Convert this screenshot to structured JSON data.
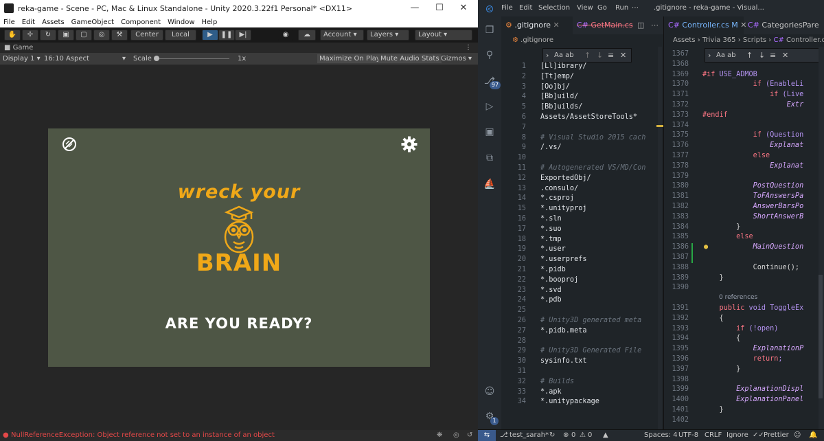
{
  "unity": {
    "title": "reka-game - Scene - PC, Mac & Linux Standalone - Unity 2020.3.22f1 Personal* <DX11>",
    "menu": [
      "File",
      "Edit",
      "Assets",
      "GameObject",
      "Component",
      "Window",
      "Help"
    ],
    "toolbar": {
      "center": "Center",
      "local": "Local",
      "account": "Account",
      "layers": "Layers",
      "layout": "Layout"
    },
    "game_tab": "Game",
    "gamebar": {
      "display": "Display 1",
      "aspect": "16:10 Aspect",
      "scale_label": "Scale",
      "scale_value": "1x",
      "maximize": "Maximize On Play",
      "mute": "Mute Audio",
      "stats": "Stats",
      "gizmos": "Gizmos"
    },
    "game": {
      "line1": "wreck your",
      "line2": "BRAIN",
      "prompt": "ARE YOU READY?"
    },
    "status": "NullReferenceException: Object reference not set to an instance of an object",
    "colors": {
      "game_bg": "#4e5645",
      "logo": "#f0a818",
      "error": "#e54848"
    }
  },
  "vscode": {
    "menu": [
      "File",
      "Edit",
      "Selection",
      "View",
      "Go",
      "Run"
    ],
    "window_title": ".gitignore - reka-game - Visual...",
    "scm_badge": "97",
    "accounts_badge": "1",
    "left": {
      "tabs": [
        {
          "label": ".gitignore",
          "active": true
        },
        {
          "label": "GetMain.cs",
          "deleted": true
        }
      ],
      "breadcrumb": ".gitignore",
      "lines": [
        {
          "n": "1",
          "t": "[Ll]ibrary/",
          "c": "pu"
        },
        {
          "n": "2",
          "t": "[Tt]emp/",
          "c": "pu"
        },
        {
          "n": "3",
          "t": "[Oo]bj/",
          "c": "pu"
        },
        {
          "n": "4",
          "t": "[Bb]uild/",
          "c": "pu"
        },
        {
          "n": "5",
          "t": "[Bb]uilds/",
          "c": "pu"
        },
        {
          "n": "6",
          "t": "Assets/AssetStoreTools*",
          "c": "pu"
        },
        {
          "n": "7",
          "t": "",
          "c": "pu"
        },
        {
          "n": "8",
          "t": "# Visual Studio 2015 cach",
          "c": "cm"
        },
        {
          "n": "9",
          "t": "/.vs/",
          "c": "pu"
        },
        {
          "n": "10",
          "t": "",
          "c": "pu"
        },
        {
          "n": "11",
          "t": "# Autogenerated VS/MD/Con",
          "c": "cm"
        },
        {
          "n": "12",
          "t": "ExportedObj/",
          "c": "pu"
        },
        {
          "n": "13",
          "t": ".consulo/",
          "c": "pu"
        },
        {
          "n": "14",
          "t": "*.csproj",
          "c": "pu"
        },
        {
          "n": "15",
          "t": "*.unityproj",
          "c": "pu"
        },
        {
          "n": "16",
          "t": "*.sln",
          "c": "pu"
        },
        {
          "n": "17",
          "t": "*.suo",
          "c": "pu"
        },
        {
          "n": "18",
          "t": "*.tmp",
          "c": "pu"
        },
        {
          "n": "19",
          "t": "*.user",
          "c": "pu"
        },
        {
          "n": "20",
          "t": "*.userprefs",
          "c": "pu"
        },
        {
          "n": "21",
          "t": "*.pidb",
          "c": "pu"
        },
        {
          "n": "22",
          "t": "*.booproj",
          "c": "pu"
        },
        {
          "n": "23",
          "t": "*.svd",
          "c": "pu"
        },
        {
          "n": "24",
          "t": "*.pdb",
          "c": "pu"
        },
        {
          "n": "25",
          "t": "",
          "c": "pu"
        },
        {
          "n": "26",
          "t": "# Unity3D generated meta",
          "c": "cm"
        },
        {
          "n": "27",
          "t": "*.pidb.meta",
          "c": "pu"
        },
        {
          "n": "28",
          "t": "",
          "c": "pu"
        },
        {
          "n": "29",
          "t": "# Unity3D Generated File",
          "c": "cm"
        },
        {
          "n": "30",
          "t": "sysinfo.txt",
          "c": "pu"
        },
        {
          "n": "31",
          "t": "",
          "c": "pu"
        },
        {
          "n": "32",
          "t": "# Builds",
          "c": "cm"
        },
        {
          "n": "33",
          "t": "*.apk",
          "c": "pu"
        },
        {
          "n": "34",
          "t": "*.unitypackage",
          "c": "pu"
        }
      ]
    },
    "right": {
      "tabs": [
        {
          "label": "Controller.cs",
          "badge": "M",
          "active": true
        },
        {
          "label": "CategoriesPare"
        }
      ],
      "breadcrumb": [
        "Assets",
        "Trivia 365",
        "Scripts",
        "Controller.cs"
      ],
      "codelens": "0 references",
      "lines": [
        {
          "n": "1367",
          "t": ""
        },
        {
          "n": "1368",
          "t": ""
        },
        {
          "n": "1369",
          "t": "#if USE_ADMOB"
        },
        {
          "n": "1370",
          "t": "            if (EnableLi"
        },
        {
          "n": "1371",
          "t": "                if (Live"
        },
        {
          "n": "1372",
          "t": "                    Extr"
        },
        {
          "n": "1373",
          "t": "#endif"
        },
        {
          "n": "1374",
          "t": ""
        },
        {
          "n": "1375",
          "t": "            if (Question"
        },
        {
          "n": "1376",
          "t": "                Explanat"
        },
        {
          "n": "1377",
          "t": "            else"
        },
        {
          "n": "1378",
          "t": "                Explanat"
        },
        {
          "n": "1379",
          "t": ""
        },
        {
          "n": "1380",
          "t": "            PostQuestion"
        },
        {
          "n": "1381",
          "t": "            ToFAnswersPa"
        },
        {
          "n": "1382",
          "t": "            AnswerBarsPo"
        },
        {
          "n": "1383",
          "t": "            ShortAnswerB"
        },
        {
          "n": "1384",
          "t": "        }"
        },
        {
          "n": "1385",
          "t": "        else"
        },
        {
          "n": "1386",
          "t": "            MainQuestion"
        },
        {
          "n": "1387",
          "t": ""
        },
        {
          "n": "1388",
          "t": "            Continue();"
        },
        {
          "n": "1389",
          "t": "    }"
        },
        {
          "n": "1390",
          "t": ""
        },
        {
          "n": "1391",
          "t": "    public void ToggleEx"
        },
        {
          "n": "1392",
          "t": "    {"
        },
        {
          "n": "1393",
          "t": "        if (!open)"
        },
        {
          "n": "1394",
          "t": "        {"
        },
        {
          "n": "1395",
          "t": "            ExplanationP"
        },
        {
          "n": "1396",
          "t": "            return;"
        },
        {
          "n": "1397",
          "t": "        }"
        },
        {
          "n": "1398",
          "t": ""
        },
        {
          "n": "1399",
          "t": "        ExplanationDispl"
        },
        {
          "n": "1400",
          "t": "        ExplanationPanel"
        },
        {
          "n": "1401",
          "t": "    }"
        },
        {
          "n": "1402",
          "t": ""
        }
      ]
    },
    "find_left": "Aa ab",
    "find_right": "Aa ab",
    "status": {
      "branch": "test_sarah*",
      "errors": "0",
      "warnings": "0",
      "spaces": "Spaces: 4",
      "encoding": "UTF-8",
      "eol": "CRLF",
      "lang": "Ignore",
      "prettier": "Prettier"
    }
  }
}
